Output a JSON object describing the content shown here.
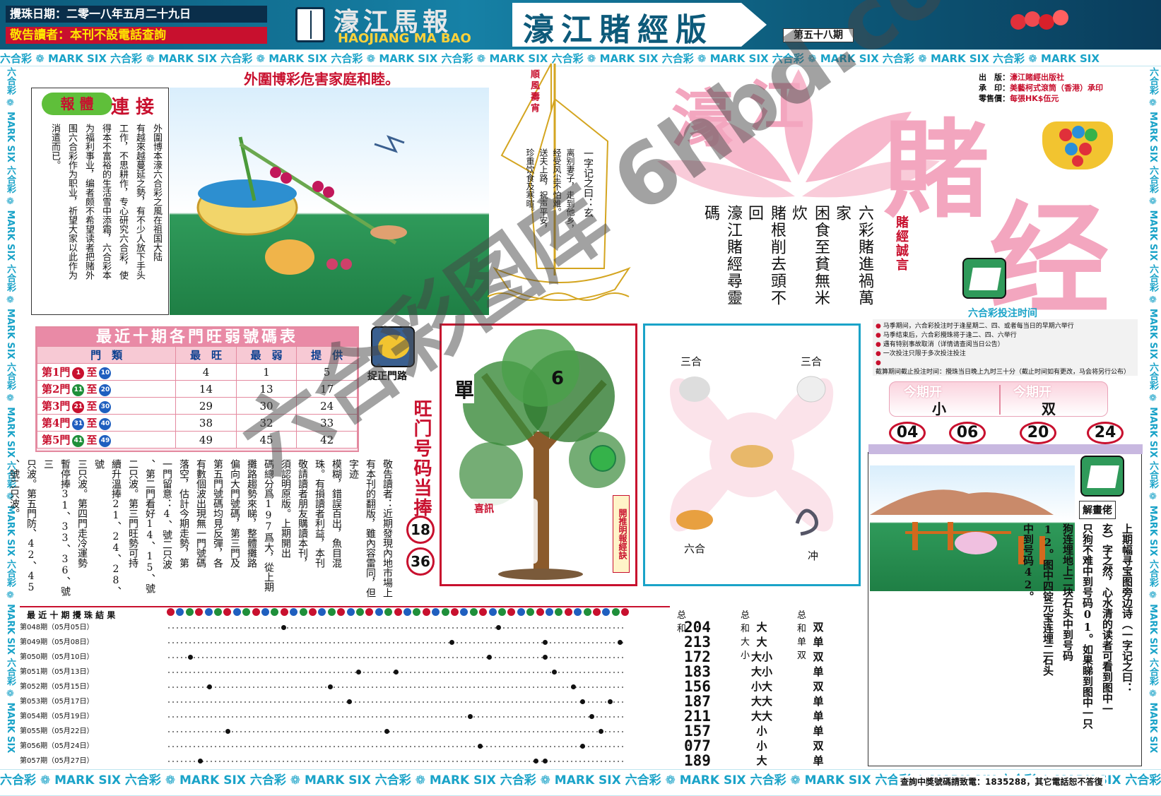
{
  "header": {
    "draw_date": "攪珠日期：二零一八年五月二十九日",
    "notice": "敬告讀者：本刊不設電話查詢",
    "paper_cn": "濠江馬報",
    "paper_en": "HAOJIANG MA BAO",
    "edition": "濠江賭經版",
    "issue": "第五十八期"
  },
  "band_text": "六合彩 ❁ MARK SIX ",
  "slogan": "外圍博彩危害家庭和睦。",
  "article": {
    "badge": "報 體",
    "title": "連 接",
    "columns": [
      "外圍博本濠六合彩之風在祖国大陆",
      "有越來越蔓延之勢，有不少人放下手头",
      "工作，不思耕作，专心研究六合彩，使",
      "得本不富裕的生活雪中添霜，六合彩本",
      "为福利事业，编者颇不希望读者把赌外",
      "围六合彩作为职业，祈望大家以此作为",
      "消遣而已。"
    ]
  },
  "boat": {
    "sail": "順風壽宵",
    "verse": [
      "一字记之曰：玄",
      "离别妻子，走到他乡，",
      "经受风尘不怕难。",
      "送夫上路，祝声平安，",
      "珍重饮食及寒暄。"
    ]
  },
  "couplets": [
    "六彩賭進禍萬家",
    "困食至貧無米炊",
    "賭根削去頭不回",
    "濠江賭經尋靈碼"
  ],
  "brand": {
    "c1": "濠",
    "c2": "江",
    "c3": "賭",
    "c4": "经",
    "subtitle": "賭經誠言"
  },
  "publisher": [
    [
      "出　版：",
      "濠江賭經出版社"
    ],
    [
      "承　印：",
      "美藝柯式滾筒（香港）承印"
    ],
    [
      "零售價：",
      "每張HK$伍元"
    ]
  ],
  "time_label": "六合彩投注时间",
  "rules": [
    "马季期间，六合彩投注时于逢星期二、四、或者每当日的早期六举行",
    "马季结束后，六合彩攪珠将于逢二、四、六举行",
    "遇有特别事故取消（详情请查阅当日公告）",
    "一次投注只限于多次投注投注",
    "截算期间截止投注时间：攪珠当日晚上九时三十分（截止时间如有更改，马会将另行公布）"
  ],
  "open": {
    "label": "今期开",
    "big_small": "小",
    "odd_even": "双",
    "numbers": [
      "04",
      "06",
      "20",
      "24"
    ]
  },
  "rank": {
    "title": "最近十期各門旺弱號碼表",
    "headers": [
      "門　類",
      "最　旺",
      "最　弱",
      "提　供"
    ],
    "rows": [
      {
        "gate": "第1門",
        "from": "1",
        "to": "10",
        "v": [
          "4",
          "1",
          "5"
        ]
      },
      {
        "gate": "第2門",
        "from": "11",
        "to": "20",
        "v": [
          "14",
          "13",
          "17"
        ]
      },
      {
        "gate": "第3門",
        "from": "21",
        "to": "30",
        "v": [
          "29",
          "30",
          "24"
        ]
      },
      {
        "gate": "第4門",
        "from": "31",
        "to": "40",
        "v": [
          "38",
          "32",
          "33"
        ]
      },
      {
        "gate": "第5門",
        "from": "41",
        "to": "49",
        "v": [
          "49",
          "45",
          "42"
        ]
      }
    ]
  },
  "analysis": [
    "敬告讀者：近期發現內地市場上",
    "有本刊的翻版，雖內容雷同，但字迹",
    "模糊，錯誤百出，魚目混",
    "珠。有損讀者利益，本刊",
    "敬請讀者朋友購讀本刊，",
    "須認明原版。上期開出",
    "碼總分爲197爲大，從上期",
    "攤路趨勢來睇，整體攤路",
    "偏向大門號碼，第三門及",
    "第五門號碼均見反彈，各",
    "有數個波出現無一門號碼",
    "落空，估計今期走勢，第",
    "一門留意：4、號二只波",
    "、第二門看好14、15、號",
    "二只波。第三門旺勢可持",
    "續升溫捧21、24、28、號",
    "三只波。第四門走冷運勢",
    "暫停捧31、33、36、號三",
    "只波。第五門防、42、45",
    "、號二只波。"
  ],
  "capture": "捉正門路",
  "hot": {
    "label": "旺门号码当捧",
    "nums": [
      "18",
      "36"
    ]
  },
  "tree": {
    "left": "單",
    "right": "6",
    "pot": "喜訊",
    "side": "開推明報經訣"
  },
  "clover": {
    "tl": "三合",
    "tr": "三合",
    "bl": "六合",
    "br": "冲"
  },
  "solve": {
    "label": "解畫佬",
    "text": [
      "上期幅寻宝图旁边诗（一字记之曰：",
      "玄）字之然，心水清的读者可看到图中一",
      "只狗不难中到号码01。如果睇到图中一只",
      "狗连埋地上二块石头中到号码",
      "12。图中四锭元宝连埋二石头",
      "中到号码42。"
    ]
  },
  "draws": {
    "title": "最 近 十 期 攪 珠 結 果",
    "head_sum": "总和",
    "head_bs": "总和大小",
    "head_oe": "总和单双",
    "rows": [
      {
        "label": "第048期（05月05日）",
        "sum": "204",
        "bs": "大",
        "oe": "双"
      },
      {
        "label": "第049期（05月08日）",
        "sum": "213",
        "bs": "大",
        "oe": "单"
      },
      {
        "label": "第050期（05月10日）",
        "sum": "172",
        "bs": "大小",
        "oe": "双"
      },
      {
        "label": "第051期（05月13日）",
        "sum": "183",
        "bs": "大小",
        "oe": "单"
      },
      {
        "label": "第052期（05月15日）",
        "sum": "156",
        "bs": "小大",
        "oe": "双"
      },
      {
        "label": "第053期（05月17日）",
        "sum": "187",
        "bs": "大大",
        "oe": "单"
      },
      {
        "label": "第054期（05月19日）",
        "sum": "211",
        "bs": "大大",
        "oe": "单"
      },
      {
        "label": "第055期（05月22日）",
        "sum": "157",
        "bs": "小",
        "oe": "单"
      },
      {
        "label": "第056期（05月24日）",
        "sum": "077",
        "bs": "小",
        "oe": "双"
      },
      {
        "label": "第057期（05月27日）",
        "sum": "189",
        "bs": "大",
        "oe": "单"
      }
    ]
  },
  "footer": "查詢中獎號碼請致電：1835288，其它電話恕不答復",
  "watermark": "六合彩图库 6hbd.com",
  "colors": {
    "red": "#c8102e",
    "blue": "#0a3f8f",
    "pink": "#f7c9d4",
    "teal": "#1aa3c8"
  }
}
